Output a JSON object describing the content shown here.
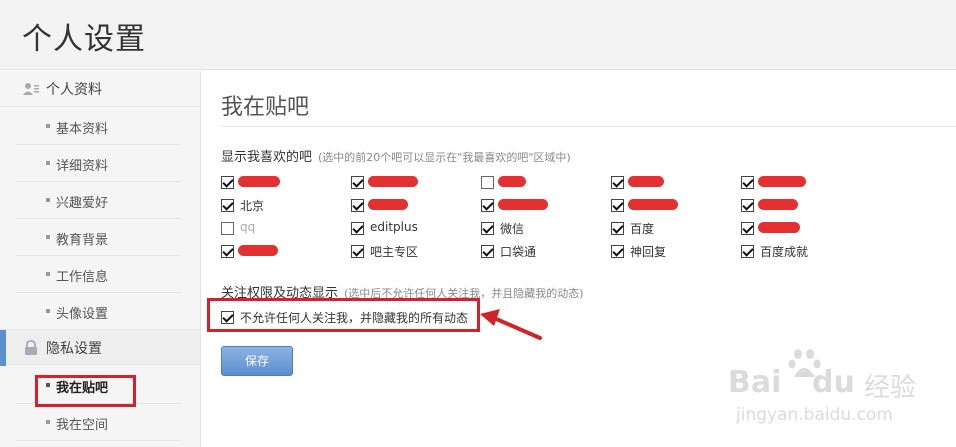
{
  "header": {
    "title": "个人设置"
  },
  "sidebar": {
    "group1": {
      "label": "个人资料",
      "icon": "user-card-icon"
    },
    "group1_items": [
      "基本资料",
      "详细资料",
      "兴趣爱好",
      "教育背景",
      "工作信息",
      "头像设置"
    ],
    "group2": {
      "label": "隐私设置",
      "icon": "lock-icon"
    },
    "group2_items": [
      "我在贴吧",
      "我在空间"
    ],
    "active_item": "我在贴吧"
  },
  "main": {
    "title": "我在贴吧",
    "section1": {
      "label": "显示我喜欢的吧",
      "hint": "(选中的前20个吧可以显示在\"我最喜欢的吧\"区域中)"
    },
    "bars": {
      "rows": [
        [
          {
            "label": "",
            "checked": true,
            "redacted": true
          },
          {
            "label": "",
            "checked": true,
            "redacted": true
          },
          {
            "label": "",
            "checked": false,
            "redacted": true
          },
          {
            "label": "",
            "checked": true,
            "redacted": true
          },
          {
            "label": "",
            "checked": true,
            "redacted": true
          }
        ],
        [
          {
            "label": "北京",
            "checked": true,
            "redacted": false
          },
          {
            "label": "",
            "checked": true,
            "redacted": true
          },
          {
            "label": "",
            "checked": true,
            "redacted": true
          },
          {
            "label": "",
            "checked": true,
            "redacted": true
          },
          {
            "label": "",
            "checked": true,
            "redacted": true
          }
        ],
        [
          {
            "label": "qq",
            "checked": false,
            "redacted": false,
            "muted": true
          },
          {
            "label": "editplus",
            "checked": true,
            "redacted": false
          },
          {
            "label": "微信",
            "checked": true,
            "redacted": false
          },
          {
            "label": "百度",
            "checked": true,
            "redacted": false
          },
          {
            "label": "",
            "checked": true,
            "redacted": true
          }
        ],
        [
          {
            "label": "",
            "checked": true,
            "redacted": true
          },
          {
            "label": "吧主专区",
            "checked": true,
            "redacted": false
          },
          {
            "label": "口袋通",
            "checked": true,
            "redacted": false
          },
          {
            "label": "神回复",
            "checked": true,
            "redacted": false
          },
          {
            "label": "百度成就",
            "checked": true,
            "redacted": false
          }
        ]
      ]
    },
    "section2": {
      "label": "关注权限及动态显示",
      "hint": "(选中后不允许任何人关注我，并且隐藏我的动态)"
    },
    "privacy_option": {
      "label": "不允许任何人关注我，并隐藏我的所有动态",
      "checked": true
    },
    "save_label": "保存"
  },
  "annotation": {
    "color": "#d2232a"
  },
  "watermark": {
    "brand": "Bai",
    "brand2": "du",
    "cn": "经验",
    "url": "jingyan.baidu.com"
  }
}
